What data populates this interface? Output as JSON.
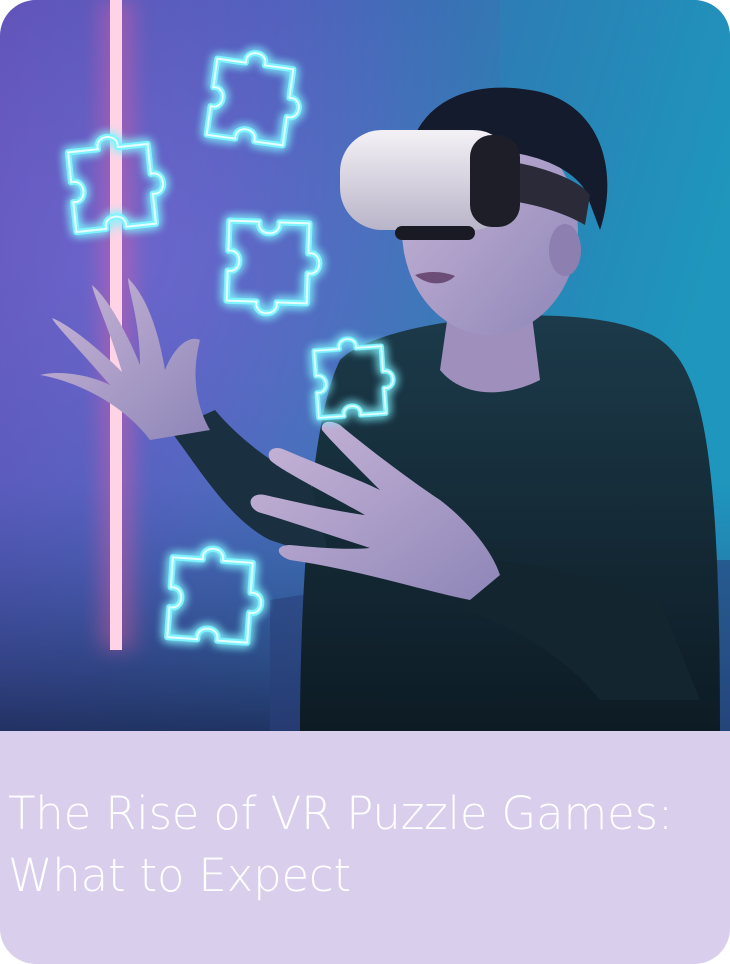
{
  "article_card": {
    "title": "The Rise of VR Puzzle Games: What to Expect",
    "image": {
      "subject": "person wearing a VR headset reaching toward glowing puzzle pieces",
      "icon": "vr-puzzle-illustration"
    }
  },
  "colors": {
    "caption_background": "#d9cfec",
    "title_text": "#ffffff",
    "neon_cyan": "#7ff4ff",
    "neon_pink": "#ff6fa8",
    "scene_blue": "#2d6f9c"
  }
}
